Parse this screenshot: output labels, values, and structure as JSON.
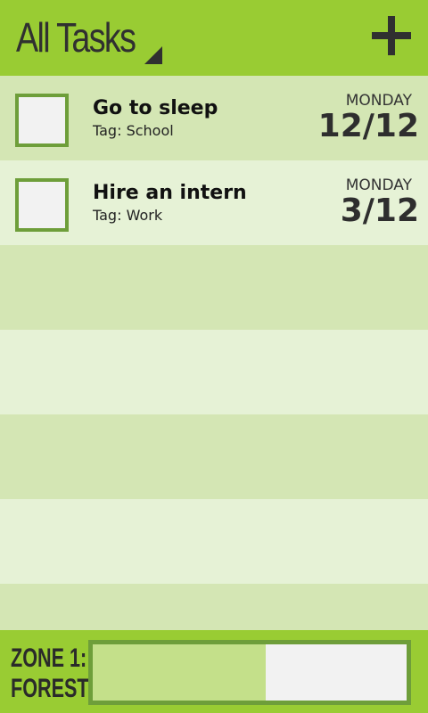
{
  "header": {
    "title": "All Tasks",
    "dropdown_icon": "dropdown-corner-icon",
    "add_icon": "plus-icon"
  },
  "tasks": [
    {
      "title": "Go to sleep",
      "tag": "Tag: School",
      "day": "MONDAY",
      "date": "12/12"
    },
    {
      "title": "Hire an intern",
      "tag": "Tag: Work",
      "day": "MONDAY",
      "date": "3/12"
    }
  ],
  "footer": {
    "zone_label": "ZONE 1:",
    "zone_name": "FOREST",
    "progress_fraction": 0.55
  },
  "colors": {
    "header": "#99cc33",
    "row_dark": "#d4e6b4",
    "row_light": "#e6f2d6",
    "checkbox_border": "#6e9e3a",
    "progress_fill": "#c4e08a"
  }
}
